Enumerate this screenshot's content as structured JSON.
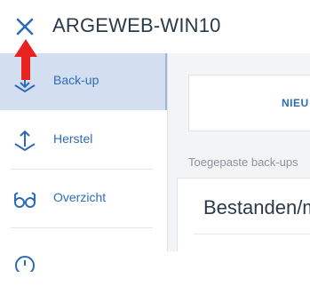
{
  "header": {
    "title": "ARGEWEB-WIN10",
    "close_icon": "close-icon"
  },
  "overlay": {
    "annotation_icon": "red-up-arrow-icon",
    "color": "#e8231f"
  },
  "sidebar": {
    "items": [
      {
        "label": "Back-up",
        "icon": "backup-download-icon",
        "active": true
      },
      {
        "label": "Herstel",
        "icon": "restore-upload-icon",
        "active": false
      },
      {
        "label": "Overzicht",
        "icon": "glasses-icon",
        "active": false
      },
      {
        "label": "",
        "icon": "clock-icon",
        "active": false
      }
    ]
  },
  "main": {
    "new_button_label": "NIEU",
    "applied_label": "Toegepaste back-ups",
    "files_card_title": "Bestanden/m"
  },
  "colors": {
    "accent": "#2d6bb8",
    "active_bg": "#d3dff0",
    "content_bg": "#f2f4f6"
  }
}
